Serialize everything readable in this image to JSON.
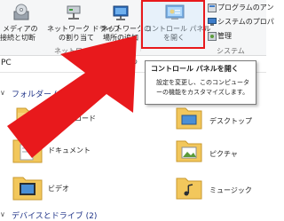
{
  "ribbon": {
    "buttons": [
      {
        "line1": "メディアの",
        "line2": "接続と切断",
        "icon": "media-disc-icon"
      },
      {
        "line1": "ネットワーク ドライブ",
        "line2": "の割り当て",
        "icon": "network-drive-icon"
      },
      {
        "line1": "ネットワークの",
        "line2": "場所の追加",
        "icon": "network-location-icon"
      },
      {
        "line1": "コントロール パネル",
        "line2": "を開く",
        "icon": "control-panel-icon"
      }
    ],
    "side_items": [
      {
        "label": "プログラムのアン",
        "icon": "programs-icon"
      },
      {
        "label": "システムのプロパ",
        "icon": "system-properties-icon"
      },
      {
        "label": "管理",
        "icon": "manage-icon"
      }
    ],
    "groups": {
      "network": "ネットワーク",
      "system": "システム"
    }
  },
  "address": {
    "path": "PC"
  },
  "tooltip": {
    "title": "コントロール パネルを開く",
    "body": "設定を変更し、このコンピューターの機能をカスタマイズします。"
  },
  "sections": {
    "folders": "フォルダー (6)",
    "devices": "デバイスとドライブ (2)"
  },
  "folders": [
    {
      "label": "ダウンロード",
      "icon": "download-folder-icon"
    },
    {
      "label": "デスクトップ",
      "icon": "desktop-folder-icon"
    },
    {
      "label": "ドキュメント",
      "icon": "documents-folder-icon"
    },
    {
      "label": "ピクチャ",
      "icon": "pictures-folder-icon"
    },
    {
      "label": "ビデオ",
      "icon": "videos-folder-icon"
    },
    {
      "label": "ミュージック",
      "icon": "music-folder-icon"
    }
  ],
  "colors": {
    "highlight": "#e8191c",
    "arrow": "#e8191c",
    "section_head": "#1e3287",
    "folder": "#f2c75c"
  }
}
